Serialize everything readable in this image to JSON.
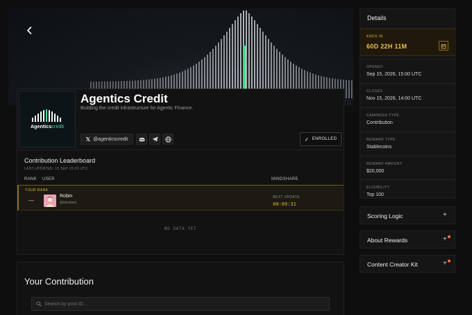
{
  "hero": {
    "back_icon": "chevron-left-icon"
  },
  "campaign": {
    "title": "Agentics Credit",
    "subtitle": "Building the credit infrastructure for Agentic Finance.",
    "logo": {
      "brand": "Agentics",
      "suffix": "credit"
    },
    "socials": [
      {
        "label": "@agenticscredit",
        "icon": "x-icon"
      },
      {
        "label": "",
        "icon": "discord-icon"
      },
      {
        "label": "",
        "icon": "telegram-icon"
      },
      {
        "label": "",
        "icon": "globe-icon"
      }
    ],
    "status": "ENROLLED"
  },
  "leaderboard": {
    "title": "Contribution Leaderboard",
    "last_updated": "LAST UPDATED: 15 SEP 15:03 UTC",
    "columns": {
      "rank": "RANK",
      "user": "USER",
      "mindshare": "MINDSHARE"
    },
    "your_rank": {
      "label": "YOUR RANK",
      "rank": "—",
      "name": "Robin",
      "handle": "@0xrobin1",
      "next_update_label": "NEXT UPDATE",
      "next_update": "00:09:31"
    },
    "empty": "NO DATA YET"
  },
  "contribution": {
    "title": "Your Contribution",
    "search_placeholder": "Search by post ID..."
  },
  "details": {
    "title": "Details",
    "ends_label": "ENDS IN",
    "ends_value": "60D 22H 11M",
    "rows": [
      {
        "label": "OPENED",
        "value": "Sep 15, 2026, 15:00 UTC"
      },
      {
        "label": "CLOSES",
        "value": "Nov 15, 2026, 14:00 UTC"
      },
      {
        "label": "CAMPAIGN TYPE",
        "value": "Contribution"
      },
      {
        "label": "REWARD TYPE",
        "value": "Stablecoins"
      },
      {
        "label": "REWARD AMOUNT",
        "value": "$20,000"
      },
      {
        "label": "ELIGIBILITY",
        "value": "Top 100"
      }
    ]
  },
  "accordions": [
    {
      "label": "Scoring Logic",
      "dot": false
    },
    {
      "label": "About Rewards",
      "dot": true
    },
    {
      "label": "Content Creator Kit",
      "dot": true
    }
  ],
  "colors": {
    "accent_gold": "#e0b33a",
    "accent_green": "#4ddf9a",
    "badge_dot": "#ff6b4a"
  }
}
